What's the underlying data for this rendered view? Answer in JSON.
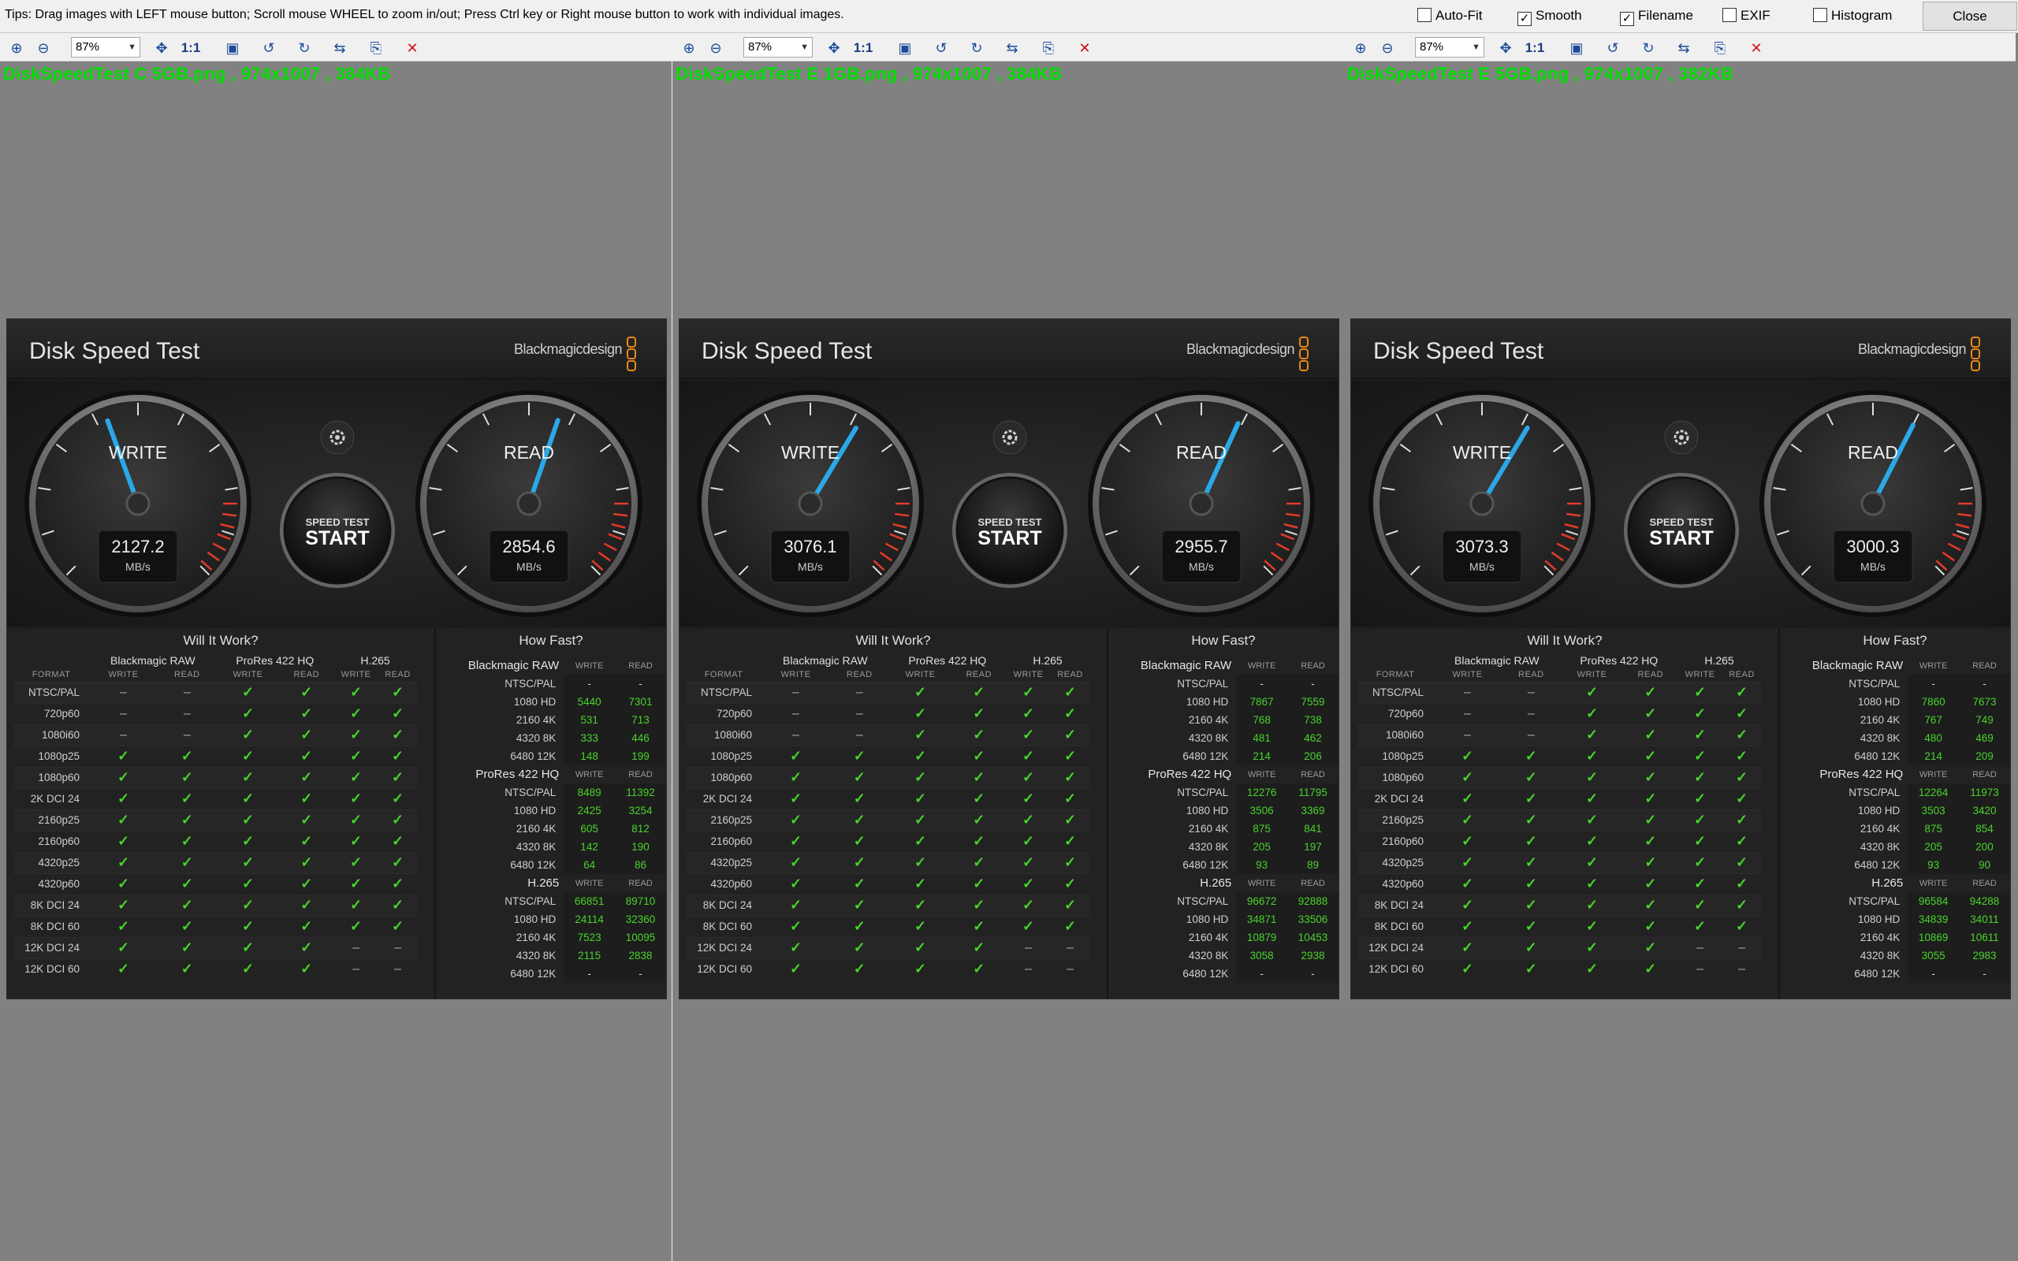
{
  "tips": "Tips: Drag images with LEFT mouse button; Scroll mouse WHEEL to zoom in/out; Press Ctrl key or Right mouse button to work with individual images.",
  "options": [
    {
      "label": "Auto-Fit",
      "checked": false
    },
    {
      "label": "Smooth",
      "checked": true
    },
    {
      "label": "Filename",
      "checked": true
    },
    {
      "label": "EXIF",
      "checked": false
    },
    {
      "label": "Histogram",
      "checked": false
    }
  ],
  "close_label": "Close",
  "toolbar": {
    "zoom": "87%",
    "one_to_one": "1:1"
  },
  "app": {
    "title": "Disk Speed Test",
    "brand": "Blackmagicdesign",
    "write_label": "WRITE",
    "read_label": "READ",
    "unit": "MB/s",
    "start_small": "SPEED TEST",
    "start_big": "START",
    "will_title": "Will It Work?",
    "how_title": "How Fast?",
    "col_groups": [
      "Blackmagic RAW",
      "ProRes 422 HQ",
      "H.265"
    ],
    "format_label": "FORMAT",
    "write_sub": "WRITE",
    "read_sub": "READ",
    "formats": [
      "NTSC/PAL",
      "720p60",
      "1080i60",
      "1080p25",
      "1080p60",
      "2K DCI 24",
      "2160p25",
      "2160p60",
      "4320p25",
      "4320p60",
      "8K DCI 24",
      "8K DCI 60",
      "12K DCI 24",
      "12K DCI 60"
    ],
    "how_groups": [
      {
        "name": "Blackmagic RAW",
        "rows": [
          "NTSC/PAL",
          "1080 HD",
          "2160 4K",
          "4320 8K",
          "6480 12K"
        ]
      },
      {
        "name": "ProRes 422 HQ",
        "rows": [
          "NTSC/PAL",
          "1080 HD",
          "2160 4K",
          "4320 8K",
          "6480 12K"
        ]
      },
      {
        "name": "H.265",
        "rows": [
          "NTSC/PAL",
          "1080 HD",
          "2160 4K",
          "4320 8K",
          "6480 12K"
        ]
      }
    ]
  },
  "panes": [
    {
      "filename": "DiskSpeedTest C 5GB.png  ,  974x1007  ,  384KB",
      "write": "2127.2",
      "read": "2854.6",
      "write_value": 2127.2,
      "read_value": 2854.6,
      "will": [
        [
          "-",
          "-",
          "y",
          "y",
          "y",
          "y"
        ],
        [
          "-",
          "-",
          "y",
          "y",
          "y",
          "y"
        ],
        [
          "-",
          "-",
          "y",
          "y",
          "y",
          "y"
        ],
        [
          "y",
          "y",
          "y",
          "y",
          "y",
          "y"
        ],
        [
          "y",
          "y",
          "y",
          "y",
          "y",
          "y"
        ],
        [
          "y",
          "y",
          "y",
          "y",
          "y",
          "y"
        ],
        [
          "y",
          "y",
          "y",
          "y",
          "y",
          "y"
        ],
        [
          "y",
          "y",
          "y",
          "y",
          "y",
          "y"
        ],
        [
          "y",
          "y",
          "y",
          "y",
          "y",
          "y"
        ],
        [
          "y",
          "y",
          "y",
          "y",
          "y",
          "y"
        ],
        [
          "y",
          "y",
          "y",
          "y",
          "y",
          "y"
        ],
        [
          "y",
          "y",
          "y",
          "y",
          "y",
          "y"
        ],
        [
          "y",
          "y",
          "y",
          "y",
          "-",
          "-"
        ],
        [
          "y",
          "y",
          "y",
          "y",
          "-",
          "-"
        ]
      ],
      "how": [
        [
          [
            "-",
            "-"
          ],
          [
            "5440",
            "7301"
          ],
          [
            "531",
            "713"
          ],
          [
            "333",
            "446"
          ],
          [
            "148",
            "199"
          ]
        ],
        [
          [
            "8489",
            "11392"
          ],
          [
            "2425",
            "3254"
          ],
          [
            "605",
            "812"
          ],
          [
            "142",
            "190"
          ],
          [
            "64",
            "86"
          ]
        ],
        [
          [
            "66851",
            "89710"
          ],
          [
            "24114",
            "32360"
          ],
          [
            "7523",
            "10095"
          ],
          [
            "2115",
            "2838"
          ],
          [
            "-",
            "-"
          ]
        ]
      ]
    },
    {
      "filename": "DiskSpeedTest E 1GB.png  ,  974x1007  ,  384KB",
      "write": "3076.1",
      "read": "2955.7",
      "write_value": 3076.1,
      "read_value": 2955.7,
      "will": [
        [
          "-",
          "-",
          "y",
          "y",
          "y",
          "y"
        ],
        [
          "-",
          "-",
          "y",
          "y",
          "y",
          "y"
        ],
        [
          "-",
          "-",
          "y",
          "y",
          "y",
          "y"
        ],
        [
          "y",
          "y",
          "y",
          "y",
          "y",
          "y"
        ],
        [
          "y",
          "y",
          "y",
          "y",
          "y",
          "y"
        ],
        [
          "y",
          "y",
          "y",
          "y",
          "y",
          "y"
        ],
        [
          "y",
          "y",
          "y",
          "y",
          "y",
          "y"
        ],
        [
          "y",
          "y",
          "y",
          "y",
          "y",
          "y"
        ],
        [
          "y",
          "y",
          "y",
          "y",
          "y",
          "y"
        ],
        [
          "y",
          "y",
          "y",
          "y",
          "y",
          "y"
        ],
        [
          "y",
          "y",
          "y",
          "y",
          "y",
          "y"
        ],
        [
          "y",
          "y",
          "y",
          "y",
          "y",
          "y"
        ],
        [
          "y",
          "y",
          "y",
          "y",
          "-",
          "-"
        ],
        [
          "y",
          "y",
          "y",
          "y",
          "-",
          "-"
        ]
      ],
      "how": [
        [
          [
            "-",
            "-"
          ],
          [
            "7867",
            "7559"
          ],
          [
            "768",
            "738"
          ],
          [
            "481",
            "462"
          ],
          [
            "214",
            "206"
          ]
        ],
        [
          [
            "12276",
            "11795"
          ],
          [
            "3506",
            "3369"
          ],
          [
            "875",
            "841"
          ],
          [
            "205",
            "197"
          ],
          [
            "93",
            "89"
          ]
        ],
        [
          [
            "96672",
            "92888"
          ],
          [
            "34871",
            "33506"
          ],
          [
            "10879",
            "10453"
          ],
          [
            "3058",
            "2938"
          ],
          [
            "-",
            "-"
          ]
        ]
      ]
    },
    {
      "filename": "DiskSpeedTest E 5GB.png  ,  974x1007  ,  382KB",
      "write": "3073.3",
      "read": "3000.3",
      "write_value": 3073.3,
      "read_value": 3000.3,
      "will": [
        [
          "-",
          "-",
          "y",
          "y",
          "y",
          "y"
        ],
        [
          "-",
          "-",
          "y",
          "y",
          "y",
          "y"
        ],
        [
          "-",
          "-",
          "y",
          "y",
          "y",
          "y"
        ],
        [
          "y",
          "y",
          "y",
          "y",
          "y",
          "y"
        ],
        [
          "y",
          "y",
          "y",
          "y",
          "y",
          "y"
        ],
        [
          "y",
          "y",
          "y",
          "y",
          "y",
          "y"
        ],
        [
          "y",
          "y",
          "y",
          "y",
          "y",
          "y"
        ],
        [
          "y",
          "y",
          "y",
          "y",
          "y",
          "y"
        ],
        [
          "y",
          "y",
          "y",
          "y",
          "y",
          "y"
        ],
        [
          "y",
          "y",
          "y",
          "y",
          "y",
          "y"
        ],
        [
          "y",
          "y",
          "y",
          "y",
          "y",
          "y"
        ],
        [
          "y",
          "y",
          "y",
          "y",
          "y",
          "y"
        ],
        [
          "y",
          "y",
          "y",
          "y",
          "-",
          "-"
        ],
        [
          "y",
          "y",
          "y",
          "y",
          "-",
          "-"
        ]
      ],
      "how": [
        [
          [
            "-",
            "-"
          ],
          [
            "7860",
            "7673"
          ],
          [
            "767",
            "749"
          ],
          [
            "480",
            "469"
          ],
          [
            "214",
            "209"
          ]
        ],
        [
          [
            "12264",
            "11973"
          ],
          [
            "3503",
            "3420"
          ],
          [
            "875",
            "854"
          ],
          [
            "205",
            "200"
          ],
          [
            "93",
            "90"
          ]
        ],
        [
          [
            "96584",
            "94288"
          ],
          [
            "34839",
            "34011"
          ],
          [
            "10869",
            "10611"
          ],
          [
            "3055",
            "2983"
          ],
          [
            "-",
            "-"
          ]
        ]
      ]
    }
  ]
}
